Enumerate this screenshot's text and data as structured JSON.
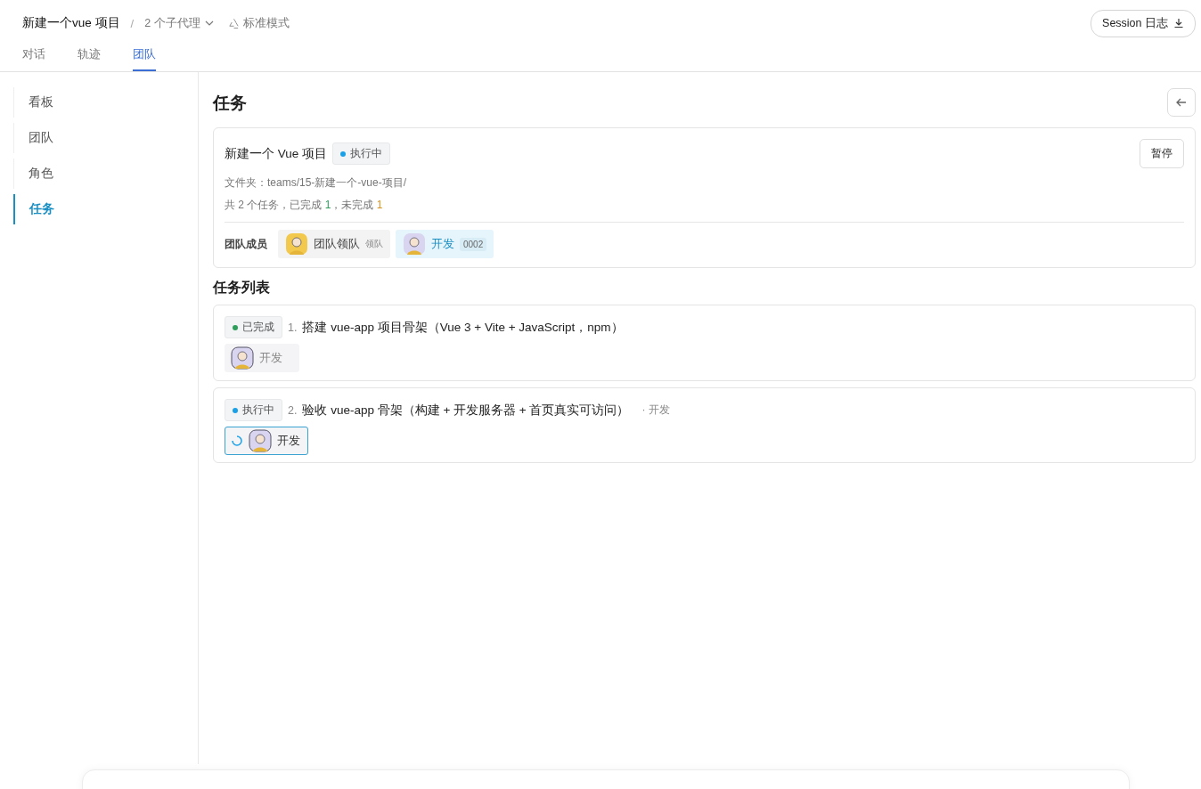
{
  "header": {
    "title": "新建一个vue 项目",
    "separator": "/",
    "agents": "2 个子代理",
    "mode": "标准模式",
    "session_button": "Session 日志"
  },
  "tabs": [
    {
      "label": "对话",
      "selected": false
    },
    {
      "label": "轨迹",
      "selected": false
    },
    {
      "label": "团队",
      "selected": true
    }
  ],
  "sidebar": {
    "items": [
      {
        "label": "看板",
        "selected": false
      },
      {
        "label": "团队",
        "selected": false
      },
      {
        "label": "角色",
        "selected": false
      },
      {
        "label": "任务",
        "selected": true
      }
    ]
  },
  "heading": "任务",
  "project": {
    "name": "新建一个 Vue 项目",
    "status": {
      "label": "执行中",
      "kind": "running"
    },
    "pause_button": "暂停",
    "folder": "文件夹：teams/15-新建一个-vue-项目/",
    "summary": {
      "before": "共 2 个任务，已完成 ",
      "done": "1",
      "middle": "，未完成 ",
      "pending": "1"
    },
    "members_label": "团队成员",
    "members": [
      {
        "name": "团队领队",
        "tag": "领队",
        "selected": false,
        "color": "#f2c94c"
      },
      {
        "name": "开发",
        "tag": "0002",
        "selected": true,
        "color": "#d9d4f0"
      }
    ]
  },
  "task_list_heading": "任务列表",
  "tasks": [
    {
      "status": {
        "label": "已完成",
        "kind": "done"
      },
      "number": "1.",
      "title": "搭建 vue-app 项目骨架（Vue 3 + Vite + JavaScript，npm）",
      "assignee": "开发",
      "running": false
    },
    {
      "status": {
        "label": "执行中",
        "kind": "running"
      },
      "number": "2.",
      "title": "验收 vue-app 骨架（构建 + 开发服务器 + 首页真实可访问）",
      "owner": "· 开发",
      "assignee": "开发",
      "running": true
    }
  ]
}
